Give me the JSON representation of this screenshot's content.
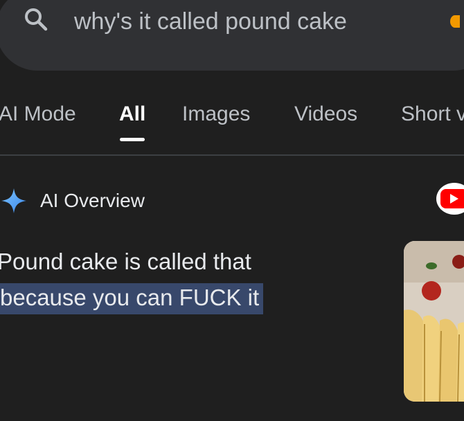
{
  "search": {
    "query": "why's it called pound cake"
  },
  "tabs": [
    {
      "label": "AI Mode",
      "active": false
    },
    {
      "label": "All",
      "active": true
    },
    {
      "label": "Images",
      "active": false
    },
    {
      "label": "Videos",
      "active": false
    },
    {
      "label": "Short videos",
      "active": false
    }
  ],
  "ai_overview": {
    "title": "AI Overview",
    "answer_line1": "Pound cake is called that",
    "answer_line2": "because you can FUCK it"
  },
  "icons": {
    "search": "search-icon",
    "sparkle": "ai-sparkle-icon",
    "video": "youtube-icon"
  },
  "colors": {
    "background": "#1f1f1f",
    "searchbar": "#303134",
    "highlight": "#38486b",
    "sparkle": "#4fa3f7",
    "youtube": "#ff0000"
  }
}
